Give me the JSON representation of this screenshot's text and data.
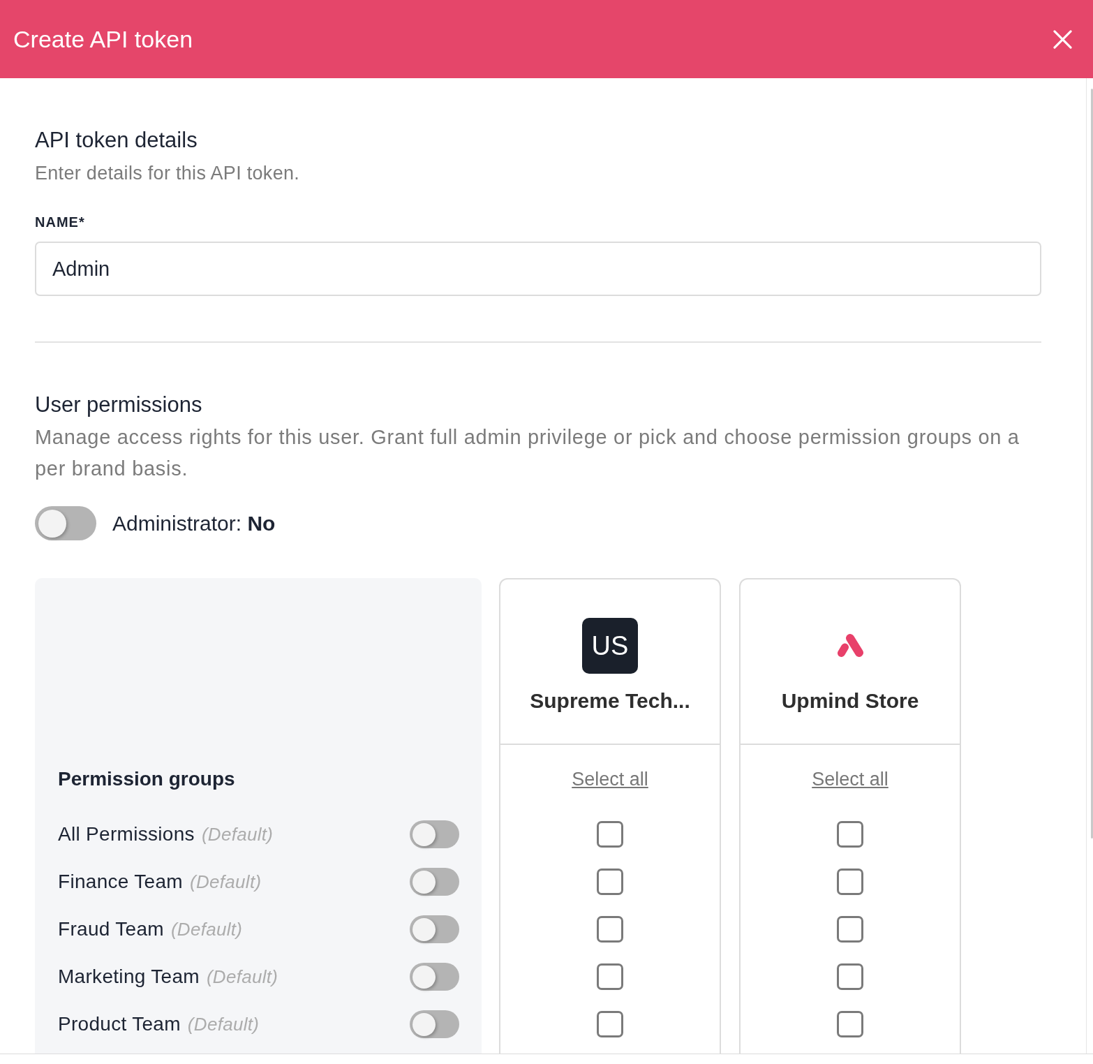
{
  "header": {
    "title": "Create API token"
  },
  "details": {
    "heading": "API token details",
    "description": "Enter details for this API token.",
    "name_field": {
      "label": "NAME*",
      "value": "Admin"
    }
  },
  "permissions": {
    "heading": "User permissions",
    "description": "Manage access rights for this user. Grant full admin privilege or pick and choose permission groups on a per brand basis.",
    "administrator": {
      "label": "Administrator: **No**",
      "on": false
    },
    "groups_heading": "Permission groups",
    "groups": [
      {
        "name": "All Permissions",
        "note": "(Default)",
        "on": false
      },
      {
        "name": "Finance Team",
        "note": "(Default)",
        "on": false
      },
      {
        "name": "Fraud Team",
        "note": "(Default)",
        "on": false
      },
      {
        "name": "Marketing Team",
        "note": "(Default)",
        "on": false
      },
      {
        "name": "Product Team",
        "note": "(Default)",
        "on": false
      }
    ],
    "brands": [
      {
        "name": "Supreme Tech...",
        "logo": {
          "kind": "initials",
          "text": "US"
        },
        "select_all": "Select all",
        "checks": [
          {
            "checked": false
          },
          {
            "checked": false
          },
          {
            "checked": false
          },
          {
            "checked": false
          },
          {
            "checked": false
          }
        ]
      },
      {
        "name": "Upmind Store",
        "logo": {
          "kind": "mark"
        },
        "select_all": "Select all",
        "checks": [
          {
            "checked": false
          },
          {
            "checked": false
          },
          {
            "checked": false
          },
          {
            "checked": false
          },
          {
            "checked": false
          }
        ]
      }
    ]
  }
}
